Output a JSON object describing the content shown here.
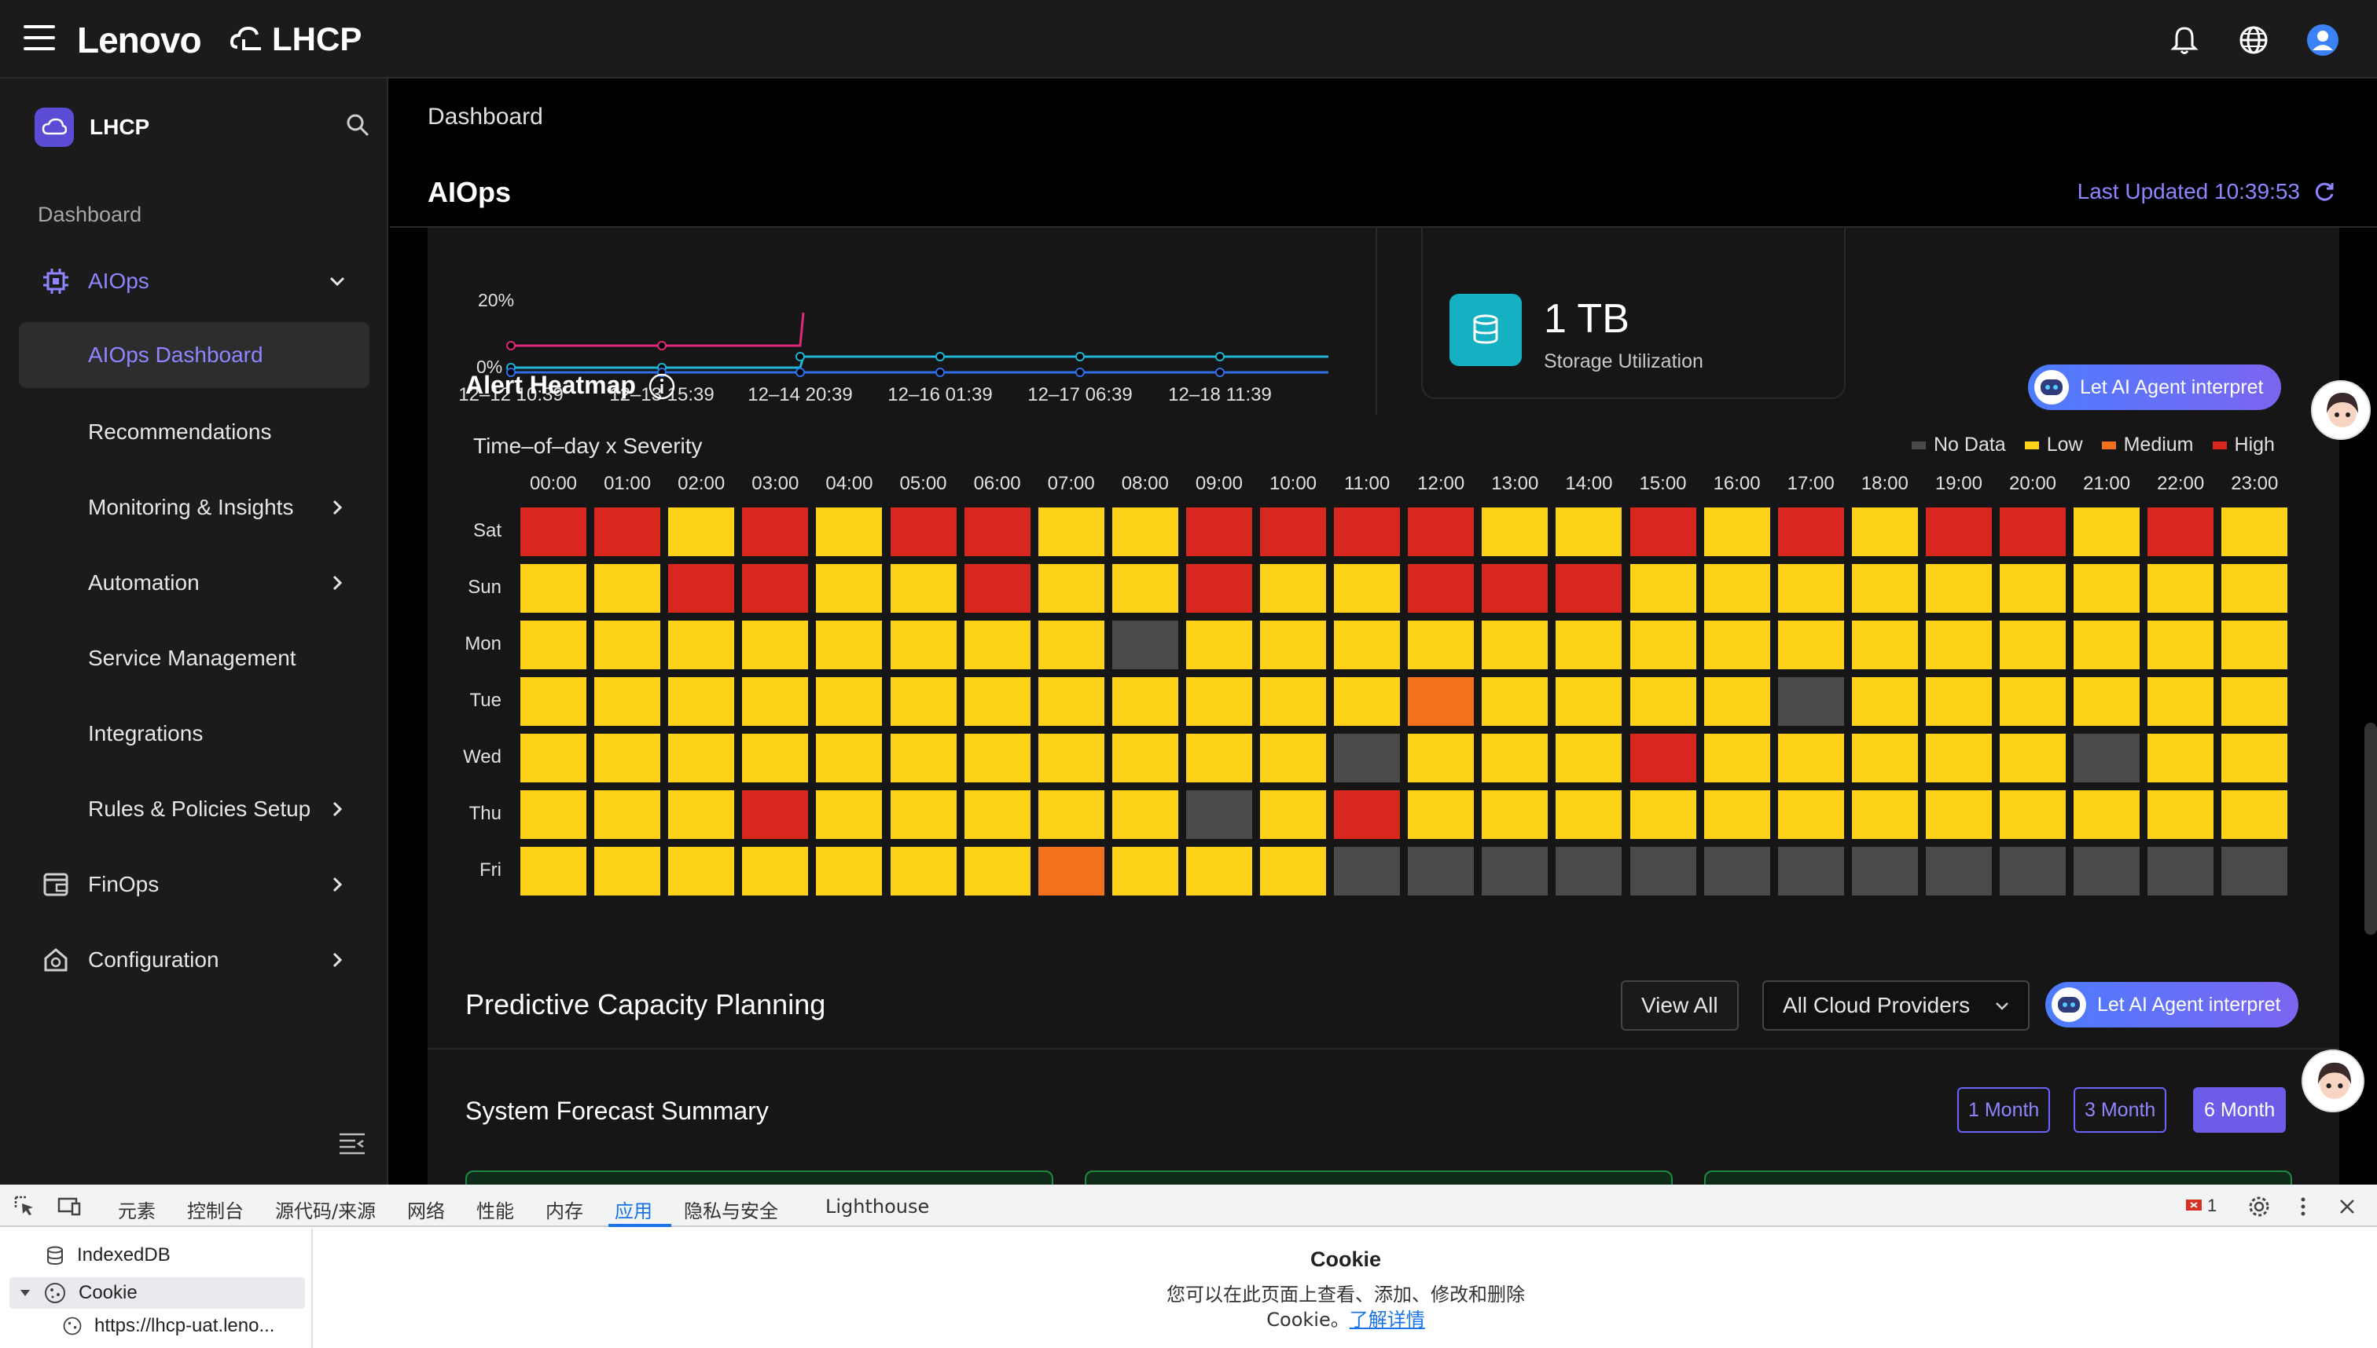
{
  "topbar": {
    "brand": "Lenovo",
    "product": "LHCP"
  },
  "sidebar": {
    "title": "LHCP",
    "section_label": "Dashboard",
    "items": [
      {
        "label": "AIOps",
        "icon": "chip-icon"
      },
      {
        "label": "AIOps Dashboard"
      },
      {
        "label": "Recommendations"
      },
      {
        "label": "Monitoring & Insights"
      },
      {
        "label": "Automation"
      },
      {
        "label": "Service Management"
      },
      {
        "label": "Integrations"
      },
      {
        "label": "Rules & Policies Setup"
      },
      {
        "label": "FinOps",
        "icon": "finops-icon"
      },
      {
        "label": "Configuration",
        "icon": "house-gear-icon"
      }
    ]
  },
  "main": {
    "breadcrumb": "Dashboard",
    "page_title": "AIOps",
    "last_updated": "Last Updated 10:39:53",
    "mini_chart": {
      "y_tick_partial": "20%",
      "y_tick_zero": "0%",
      "x_ticks": [
        "12–12 10:39",
        "12–13 15:39",
        "12–14 20:39",
        "12–16 01:39",
        "12–17 06:39",
        "12–18 11:39"
      ]
    },
    "storage": {
      "value": "1 TB",
      "label": "Storage Utilization"
    },
    "heatmap": {
      "title": "Alert Heatmap",
      "subtitle": "Time–of–day x Severity",
      "ai_button": "Let AI Agent interpret",
      "legend": [
        {
          "label": "No Data",
          "color": "#4a4a4a"
        },
        {
          "label": "Low",
          "color": "#ffd21a"
        },
        {
          "label": "Medium",
          "color": "#f2711c"
        },
        {
          "label": "High",
          "color": "#d8271f"
        }
      ],
      "hours": [
        "00:00",
        "01:00",
        "02:00",
        "03:00",
        "04:00",
        "05:00",
        "06:00",
        "07:00",
        "08:00",
        "09:00",
        "10:00",
        "11:00",
        "12:00",
        "13:00",
        "14:00",
        "15:00",
        "16:00",
        "17:00",
        "18:00",
        "19:00",
        "20:00",
        "21:00",
        "22:00",
        "23:00"
      ],
      "days": [
        "Sat",
        "Sun",
        "Mon",
        "Tue",
        "Wed",
        "Thu",
        "Fri"
      ],
      "grid": [
        "HHLHLHHLLHHHHLLHLHLHHLHL",
        "LLHHLLHLLHLLHHHLLLLLLLLL",
        "LLLLLLLLNLLLLLLLLLLLLLLL",
        "LLLLLLLLLLLLMLLLLNLLLLLL",
        "LLLLLLLLLLLNLLLHLLLLLNLL",
        "LLLHLLLLLNLHLLLLLLLLLLLL",
        "LLLLLLLMLLLNNNNNNNNNNNNN"
      ]
    }
  },
  "capacity": {
    "title": "Predictive Capacity Planning",
    "view_all": "View All",
    "provider_select": "All Cloud Providers",
    "ai_button": "Let AI Agent interpret",
    "forecast_title": "System Forecast Summary",
    "months": [
      "1 Month",
      "3 Month",
      "6 Month"
    ],
    "selected_month": "6 Month"
  },
  "devtools": {
    "tabs": [
      "元素",
      "控制台",
      "源代码/来源",
      "网络",
      "性能",
      "内存",
      "应用",
      "隐私与安全",
      "Lighthouse"
    ],
    "selected_tab": "应用",
    "error_count": "1",
    "tree": [
      {
        "label": "IndexedDB"
      },
      {
        "label": "Cookie"
      },
      {
        "label": "https://lhcp-uat.leno..."
      }
    ],
    "cookie_title": "Cookie",
    "cookie_desc_line1": "您可以在此页面上查看、添加、修改和删除",
    "cookie_desc_line2": "Cookie。",
    "cookie_link": "了解详情"
  }
}
